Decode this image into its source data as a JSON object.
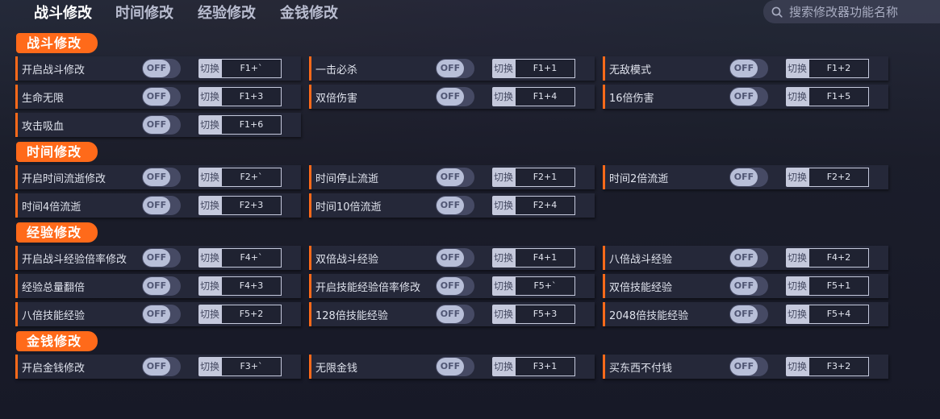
{
  "tabs": [
    "战斗修改",
    "时间修改",
    "经验修改",
    "金钱修改"
  ],
  "search": {
    "placeholder": "搜索修改器功能名称"
  },
  "toggle_label": "OFF",
  "hotkey_label": "切换",
  "sections": [
    {
      "title": "战斗修改",
      "items": [
        {
          "name": "开启战斗修改",
          "hotkey": "F1+`"
        },
        {
          "name": "一击必杀",
          "hotkey": "F1+1"
        },
        {
          "name": "无敌模式",
          "hotkey": "F1+2"
        },
        {
          "name": "生命无限",
          "hotkey": "F1+3"
        },
        {
          "name": "双倍伤害",
          "hotkey": "F1+4"
        },
        {
          "name": "16倍伤害",
          "hotkey": "F1+5"
        },
        {
          "name": "攻击吸血",
          "hotkey": "F1+6"
        }
      ]
    },
    {
      "title": "时间修改",
      "items": [
        {
          "name": "开启时间流逝修改",
          "hotkey": "F2+`"
        },
        {
          "name": "时间停止流逝",
          "hotkey": "F2+1"
        },
        {
          "name": "时间2倍流逝",
          "hotkey": "F2+2"
        },
        {
          "name": "时间4倍流逝",
          "hotkey": "F2+3"
        },
        {
          "name": "时间10倍流逝",
          "hotkey": "F2+4"
        }
      ]
    },
    {
      "title": "经验修改",
      "items": [
        {
          "name": "开启战斗经验倍率修改",
          "hotkey": "F4+`"
        },
        {
          "name": "双倍战斗经验",
          "hotkey": "F4+1"
        },
        {
          "name": "八倍战斗经验",
          "hotkey": "F4+2"
        },
        {
          "name": "经验总量翻倍",
          "hotkey": "F4+3"
        },
        {
          "name": "开启技能经验倍率修改",
          "hotkey": "F5+`"
        },
        {
          "name": "双倍技能经验",
          "hotkey": "F5+1"
        },
        {
          "name": "八倍技能经验",
          "hotkey": "F5+2"
        },
        {
          "name": "128倍技能经验",
          "hotkey": "F5+3"
        },
        {
          "name": "2048倍技能经验",
          "hotkey": "F5+4"
        }
      ]
    },
    {
      "title": "金钱修改",
      "items": [
        {
          "name": "开启金钱修改",
          "hotkey": "F3+`"
        },
        {
          "name": "无限金钱",
          "hotkey": "F3+1"
        },
        {
          "name": "买东西不付钱",
          "hotkey": "F3+2"
        }
      ]
    }
  ],
  "colors": {
    "accent": "#ff6a1a",
    "panel": "#26293a",
    "toggle_track": "#464a64",
    "toggle_knob": "#b8bfd8"
  }
}
